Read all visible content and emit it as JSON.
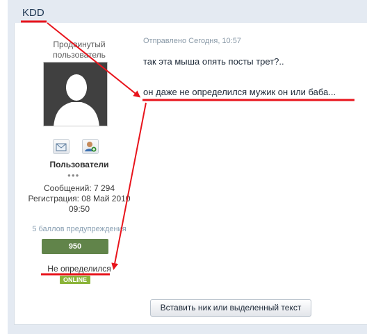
{
  "post": {
    "author": "KDD",
    "posted_label": "Отправлено Сегодня, 10:57",
    "lines": [
      "так эта мыша опять посты трет?..",
      "он даже не определился мужик он или баба..."
    ]
  },
  "author_panel": {
    "rank_line1": "Продвинутый",
    "rank_line2": "пользователь",
    "group": "Пользователи",
    "pips": "●●●",
    "posts": "Сообщений: 7 294",
    "registered": "Регистрация: 08 Май 2010",
    "registered_time": "09:50",
    "warning_points": "5 баллов предупреждения",
    "reputation": "950",
    "gender": "Не определился",
    "status": "ONLINE"
  },
  "buttons": {
    "insert_nick": "Вставить ник или выделенный текст"
  },
  "icons": [
    "message-icon",
    "add-user-icon",
    "avatar-silhouette-icon"
  ],
  "colors": {
    "header_bg": "#e4eaf2",
    "reputation_bg": "#61844a",
    "online_bg": "#8bb43a",
    "annotation_red": "#e8141c"
  }
}
